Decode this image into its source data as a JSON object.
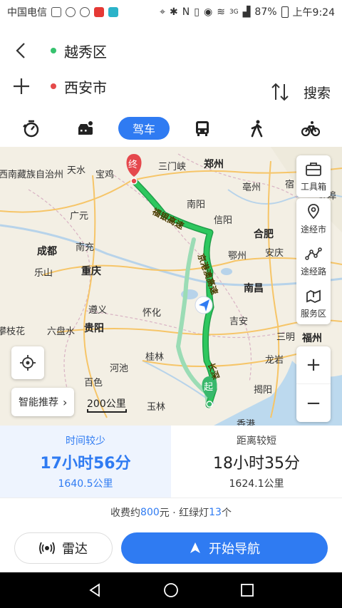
{
  "status_bar": {
    "carrier": "中国电信",
    "network": "3G",
    "battery": "87%",
    "time": "上午9:24"
  },
  "route": {
    "origin": "越秀区",
    "destination": "西安市",
    "search_label": "搜索",
    "origin_color": "#36c26e",
    "destination_color": "#e54a4a"
  },
  "modes": {
    "drive_label": "驾车",
    "items": [
      "taxi-icon",
      "carpool-icon",
      "drive",
      "bus-icon",
      "walk-icon",
      "bike-icon"
    ]
  },
  "map": {
    "cities": [
      {
        "name": "西南藏族自治州",
        "big": false
      },
      {
        "name": "天水",
        "big": false
      },
      {
        "name": "宝鸡",
        "big": false
      },
      {
        "name": "三门峡",
        "big": false
      },
      {
        "name": "郑州",
        "big": true
      },
      {
        "name": "宿",
        "big": false
      },
      {
        "name": "亳州",
        "big": false
      },
      {
        "name": "南阳",
        "big": false
      },
      {
        "name": "蚌埠",
        "big": false
      },
      {
        "name": "广元",
        "big": false
      },
      {
        "name": "信阳",
        "big": false
      },
      {
        "name": "合肥",
        "big": true
      },
      {
        "name": "成都",
        "big": true
      },
      {
        "name": "南充",
        "big": false
      },
      {
        "name": "鄂州",
        "big": false
      },
      {
        "name": "安庆",
        "big": false
      },
      {
        "name": "乐山",
        "big": false
      },
      {
        "name": "重庆",
        "big": true
      },
      {
        "name": "南昌",
        "big": true
      },
      {
        "name": "遵义",
        "big": false
      },
      {
        "name": "怀化",
        "big": false
      },
      {
        "name": "吉安",
        "big": false
      },
      {
        "name": "三明",
        "big": false
      },
      {
        "name": "福州",
        "big": true
      },
      {
        "name": "攀枝花",
        "big": false
      },
      {
        "name": "六盘水",
        "big": false
      },
      {
        "name": "贵阳",
        "big": true
      },
      {
        "name": "桂林",
        "big": false
      },
      {
        "name": "龙岩",
        "big": false
      },
      {
        "name": "河池",
        "big": false
      },
      {
        "name": "百色",
        "big": false
      },
      {
        "name": "揭阳",
        "big": false
      },
      {
        "name": "玉林",
        "big": false
      },
      {
        "name": "香港",
        "big": false
      }
    ],
    "road_labels": [
      "福银高速",
      "京港澳高速",
      "长深"
    ],
    "end_marker": "终",
    "start_marker": "起",
    "tools": [
      {
        "label": "工具箱",
        "icon": "toolbox-icon"
      },
      {
        "label": "途经市",
        "icon": "pin-icon"
      },
      {
        "label": "途经路",
        "icon": "route-icon"
      },
      {
        "label": "服务区",
        "icon": "service-area-icon"
      }
    ],
    "smart_label": "智能推荐",
    "scale": "200公里"
  },
  "plans": [
    {
      "tag": "时间较少",
      "time": "17小时56分",
      "distance": "1640.5公里"
    },
    {
      "tag": "距离较短",
      "time": "18小时35分",
      "distance": "1624.1公里"
    }
  ],
  "fee": {
    "prefix": "收费约",
    "amount": "800",
    "mid": "元 · 红绿灯",
    "lights": "13",
    "suffix": "个"
  },
  "actions": {
    "radar_label": "雷达",
    "navigate_label": "开始导航"
  },
  "colors": {
    "accent": "#2f7bf2",
    "route_primary": "#2ec75e",
    "route_alt": "#9bdcb5"
  }
}
